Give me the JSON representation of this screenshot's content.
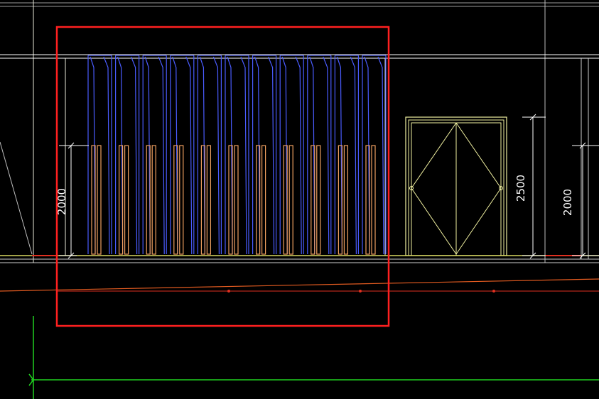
{
  "drawing": {
    "background": "#000000",
    "colors": {
      "outline": "#FFFFFF",
      "wall_line": "#E8E8D8",
      "blue_panel": "#4A5CFF",
      "orange_panel": "#F0A060",
      "door": "#F0F0A0",
      "floor_yellow": "#D8D860",
      "floor_red": "#E03020",
      "orange_line": "#E05A20",
      "green_axis": "#20D020",
      "highlight_box": "#FF2020",
      "dimension": "#FFFFFF"
    }
  },
  "dimensions": {
    "left_height": "2000",
    "door_height": "2500",
    "right_height": "2000"
  },
  "elements": {
    "folding_door_panels": 11,
    "double_door": "double-swing-door",
    "highlight": "selection-box"
  }
}
